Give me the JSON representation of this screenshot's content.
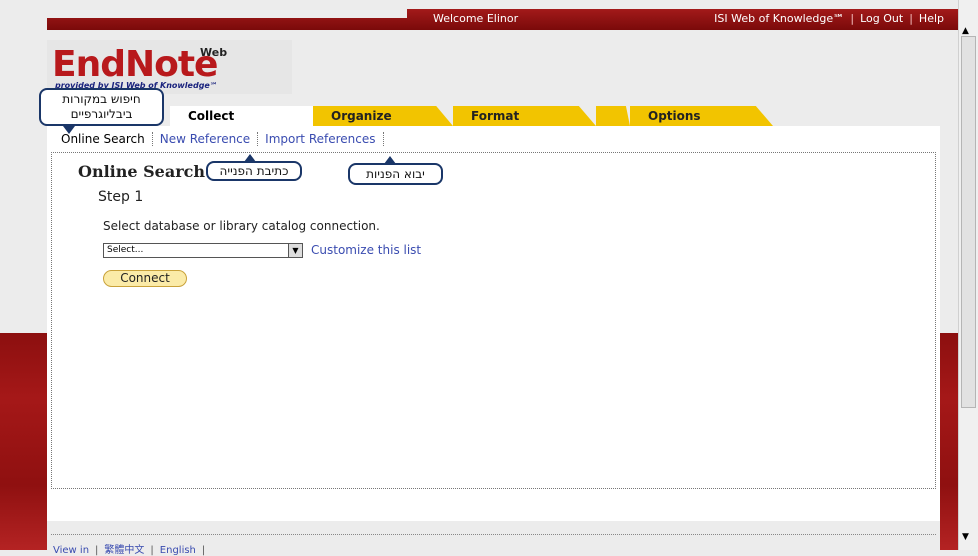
{
  "topbar": {
    "welcome": "Welcome Elinor",
    "links": [
      "ISI Web of Knowledge℠",
      "Log Out",
      "Help"
    ]
  },
  "logo": {
    "name": "EndNote",
    "superscript": "Web",
    "tagline": "provided by ISI Web of Knowledge℠"
  },
  "tabs": [
    "Collect",
    "Organize",
    "Format",
    "Options"
  ],
  "subtabs": [
    "Online Search",
    "New Reference",
    "Import References"
  ],
  "main": {
    "heading": "Online Search",
    "step": "Step 1",
    "instruction": "Select database or library catalog connection.",
    "select_value": "Select...",
    "customize_link": "Customize this list",
    "connect_button": "Connect"
  },
  "callouts": {
    "online_search": [
      "חיפוש במקורות",
      "ביבליוגרפיים"
    ],
    "new_reference": "כתיבת הפנייה",
    "import_references": "יבוא הפניות"
  },
  "footer": [
    "View in",
    "繁體中文",
    "English"
  ],
  "colors": {
    "brand_red": "#8f1010",
    "tab_yellow": "#f2c400",
    "link_blue": "#3a4cb0",
    "callout_border": "#1a3668"
  }
}
